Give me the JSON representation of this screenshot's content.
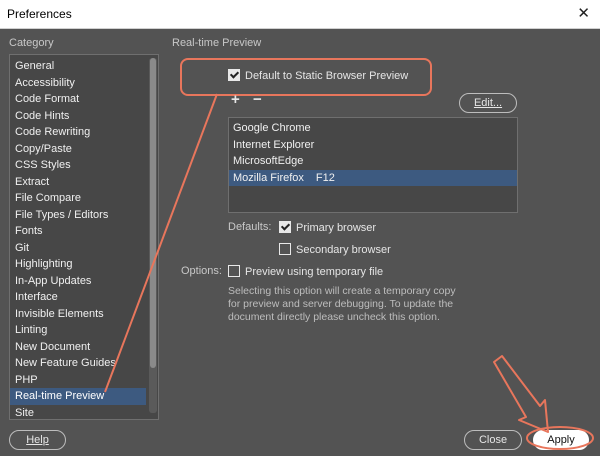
{
  "window": {
    "title": "Preferences",
    "close_glyph": "✕"
  },
  "category": {
    "label": "Category",
    "items": [
      "General",
      "Accessibility",
      "Code Format",
      "Code Hints",
      "Code Rewriting",
      "Copy/Paste",
      "CSS Styles",
      "Extract",
      "File Compare",
      "File Types / Editors",
      "Fonts",
      "Git",
      "Highlighting",
      "In-App Updates",
      "Interface",
      "Invisible Elements",
      "Linting",
      "New Document",
      "New Feature Guides",
      "PHP",
      "Real-time Preview",
      "Site"
    ],
    "selected_index": 20
  },
  "panel": {
    "title": "Real-time Preview",
    "default_static_preview": {
      "label": "Default to Static Browser Preview",
      "checked": true
    },
    "add_glyph": "+",
    "remove_glyph": "−",
    "edit_button": "Edit...",
    "browsers": [
      {
        "name": "Google Chrome",
        "shortcut": ""
      },
      {
        "name": "Internet Explorer",
        "shortcut": ""
      },
      {
        "name": "MicrosoftEdge",
        "shortcut": ""
      },
      {
        "name": "Mozilla Firefox",
        "shortcut": "F12"
      }
    ],
    "selected_browser_index": 3,
    "defaults_label": "Defaults:",
    "primary_browser": {
      "label": "Primary browser",
      "checked": true
    },
    "secondary_browser": {
      "label": "Secondary browser",
      "checked": false
    },
    "options_label": "Options:",
    "temp_file": {
      "label": "Preview using temporary file",
      "checked": false
    },
    "description": "Selecting this option will create a temporary copy for preview and server debugging. To update the document directly please uncheck this option."
  },
  "footer": {
    "help": "Help",
    "close": "Close",
    "apply": "Apply"
  },
  "colors": {
    "annotation": "#e8765c",
    "selection": "#3d5a80",
    "background": "#535353"
  }
}
